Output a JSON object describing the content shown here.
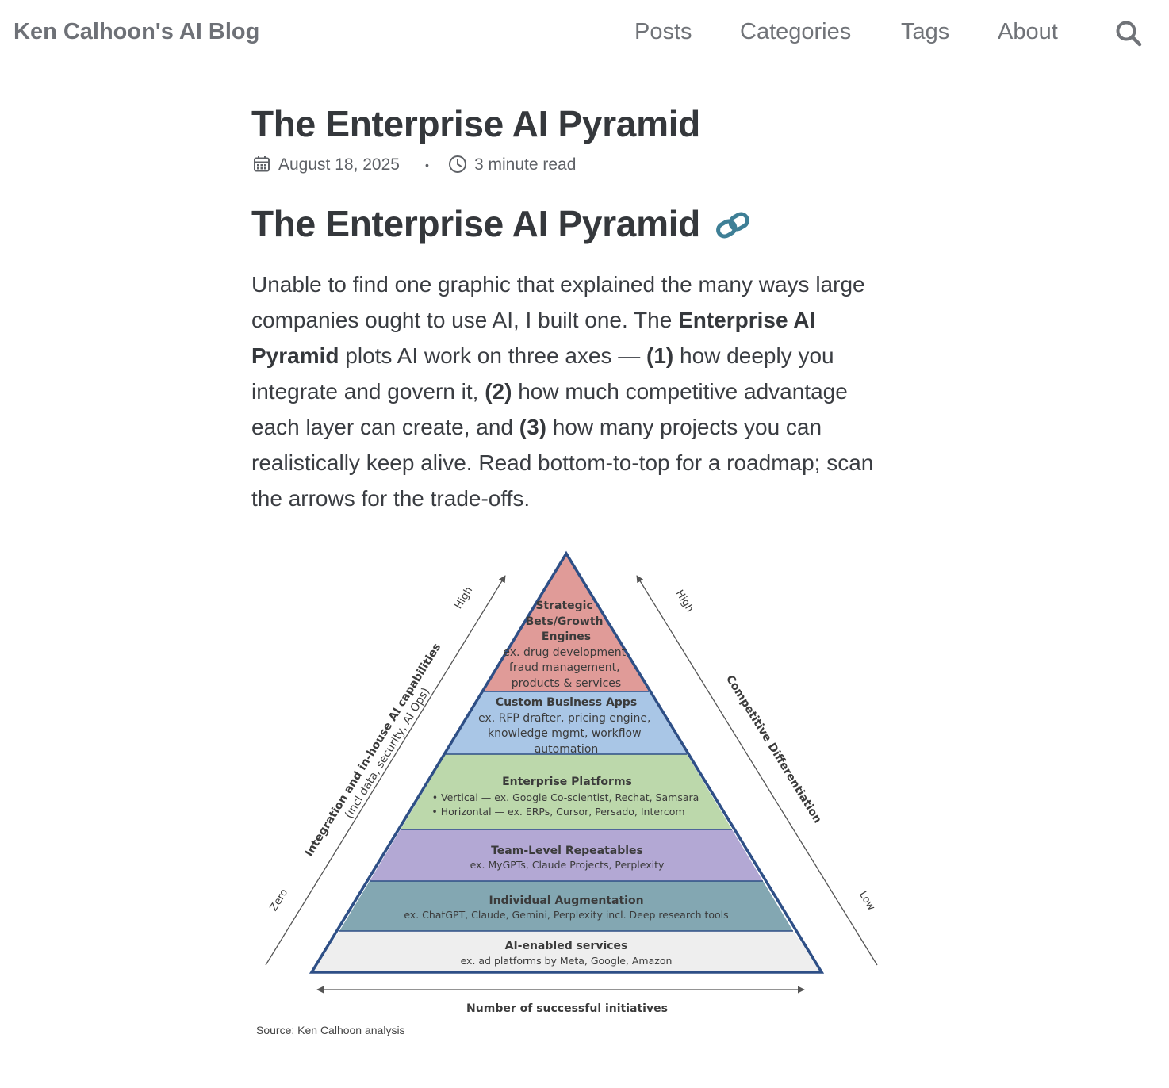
{
  "site": {
    "title": "Ken Calhoon's AI Blog"
  },
  "nav": {
    "items": [
      {
        "label": "Posts"
      },
      {
        "label": "Categories"
      },
      {
        "label": "Tags"
      },
      {
        "label": "About"
      }
    ],
    "search_icon": "search-icon"
  },
  "post": {
    "title": "The Enterprise AI Pyramid",
    "date": "August 18, 2025",
    "separator": "•",
    "read_time": "3 minute read",
    "heading": "The Enterprise AI Pyramid",
    "intro": {
      "t1": "Unable to find one graphic that explained the many ways large companies ought to use AI, I built one. The ",
      "b1": "Enterprise AI Pyramid",
      "t2": " plots AI work on three axes — ",
      "b2": "(1)",
      "t3": " how deeply you integrate and govern it, ",
      "b3": "(2)",
      "t4": " how much competitive advantage each layer can create, and ",
      "b4": "(3)",
      "t5": " how many projects you can realistically keep alive. Read bottom-to-top for a roadmap; scan the arrows for the trade-offs."
    }
  },
  "figure": {
    "caption": "Source: Ken Calhoon analysis",
    "left_axis": {
      "title": "Integration and in-house AI capabilities",
      "subtitle": "(incl data, security, AI Ops)",
      "low": "Zero",
      "high": "High"
    },
    "right_axis": {
      "title": "Competitive Differentiation",
      "low": "Low",
      "high": "High"
    },
    "bottom_axis": {
      "title": "Number of successful initiatives"
    },
    "layers": [
      {
        "title_lines": [
          "Strategic",
          "Bets/Growth",
          "Engines"
        ],
        "detail_lines": [
          "ex. drug development",
          "fraud management,",
          "products & services"
        ],
        "color": "#e09b98"
      },
      {
        "title_lines": [
          "Custom Business Apps"
        ],
        "detail_lines": [
          "ex. RFP drafter, pricing engine,",
          "knowledge mgmt, workflow",
          "automation"
        ],
        "color": "#a9c6e6"
      },
      {
        "title_lines": [
          "Enterprise  Platforms"
        ],
        "detail_lines": [
          "• Vertical — ex. Google Co-scientist, Rechat, Samsara",
          "• Horizontal — ex. ERPs, Cursor, Persado, Intercom"
        ],
        "color": "#bcd8ab"
      },
      {
        "title_lines": [
          "Team-Level Repeatables"
        ],
        "detail_lines": [
          "ex. MyGPTs, Claude Projects, Perplexity"
        ],
        "color": "#b3a8d4"
      },
      {
        "title_lines": [
          "Individual Augmentation"
        ],
        "detail_lines": [
          "ex. ChatGPT, Claude, Gemini, Perplexity incl. Deep research tools"
        ],
        "color": "#83a7b2"
      },
      {
        "title_lines": [
          "AI-enabled services"
        ],
        "detail_lines": [
          "ex. ad platforms by Meta, Google, Amazon"
        ],
        "color": "#eeeeee"
      }
    ],
    "outline_color": "#2e4f86"
  },
  "colors": {
    "link_icon": "#3e7f96",
    "text": "#35383c",
    "nav_text": "#707378"
  }
}
